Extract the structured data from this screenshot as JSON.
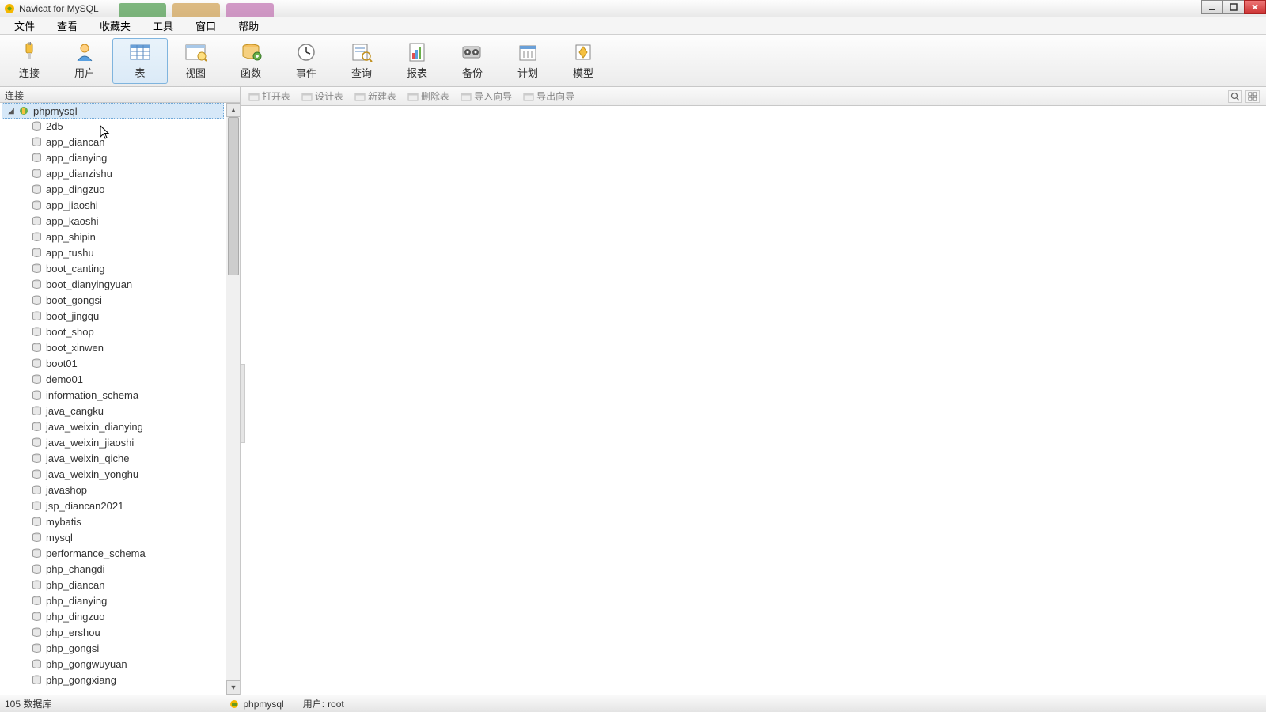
{
  "title": "Navicat for MySQL",
  "menu": [
    "文件",
    "查看",
    "收藏夹",
    "工具",
    "窗口",
    "帮助"
  ],
  "toolbar": [
    {
      "id": "connect",
      "label": "连接",
      "icon": "plug"
    },
    {
      "id": "user",
      "label": "用户",
      "icon": "user"
    },
    {
      "id": "table",
      "label": "表",
      "icon": "table",
      "active": true
    },
    {
      "id": "view",
      "label": "视图",
      "icon": "view"
    },
    {
      "id": "function",
      "label": "函数",
      "icon": "func"
    },
    {
      "id": "event",
      "label": "事件",
      "icon": "event"
    },
    {
      "id": "query",
      "label": "查询",
      "icon": "query"
    },
    {
      "id": "report",
      "label": "报表",
      "icon": "report"
    },
    {
      "id": "backup",
      "label": "备份",
      "icon": "backup"
    },
    {
      "id": "schedule",
      "label": "计划",
      "icon": "schedule"
    },
    {
      "id": "model",
      "label": "模型",
      "icon": "model"
    }
  ],
  "left_header": "连接",
  "sub_toolbar": [
    {
      "id": "open",
      "label": "打开表"
    },
    {
      "id": "design",
      "label": "设计表"
    },
    {
      "id": "new",
      "label": "新建表"
    },
    {
      "id": "delete",
      "label": "删除表"
    },
    {
      "id": "import",
      "label": "导入向导"
    },
    {
      "id": "export",
      "label": "导出向导"
    }
  ],
  "connection": {
    "name": "phpmysql",
    "selected": true
  },
  "databases": [
    "2d5",
    "app_diancan",
    "app_dianying",
    "app_dianzishu",
    "app_dingzuo",
    "app_jiaoshi",
    "app_kaoshi",
    "app_shipin",
    "app_tushu",
    "boot_canting",
    "boot_dianyingyuan",
    "boot_gongsi",
    "boot_jingqu",
    "boot_shop",
    "boot_xinwen",
    "boot01",
    "demo01",
    "information_schema",
    "java_cangku",
    "java_weixin_dianying",
    "java_weixin_jiaoshi",
    "java_weixin_qiche",
    "java_weixin_yonghu",
    "javashop",
    "jsp_diancan2021",
    "mybatis",
    "mysql",
    "performance_schema",
    "php_changdi",
    "php_diancan",
    "php_dianying",
    "php_dingzuo",
    "php_ershou",
    "php_gongsi",
    "php_gongwuyuan",
    "php_gongxiang"
  ],
  "status": {
    "db_count": "105 数据库",
    "connection": "phpmysql",
    "user_label": "用户: ",
    "user": "root"
  }
}
